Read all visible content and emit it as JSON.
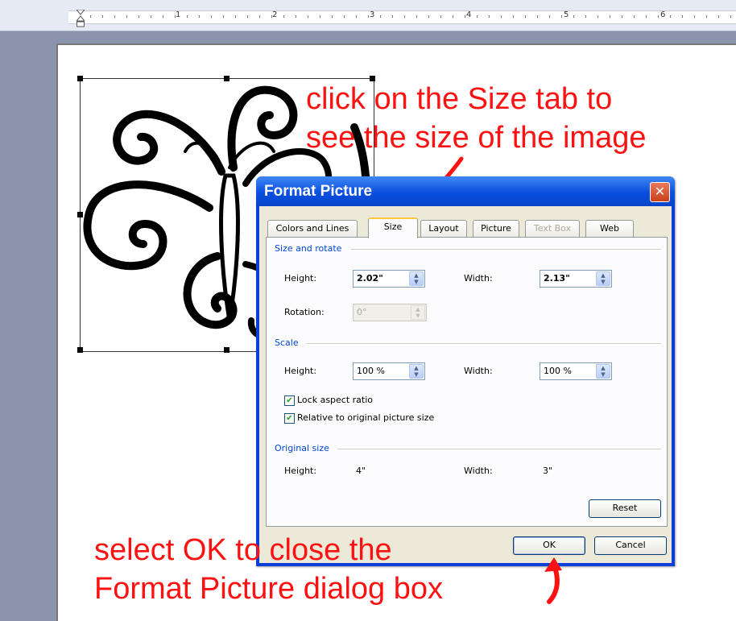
{
  "ruler": {
    "numbers": [
      "1",
      "2",
      "3",
      "4",
      "5",
      "6"
    ]
  },
  "annotations": {
    "top_line1": "click on the Size tab to",
    "top_line2": "see the size of the image",
    "bottom_line1": "select OK to close the",
    "bottom_line2": "Format Picture dialog box"
  },
  "dialog": {
    "title": "Format Picture",
    "close_icon": "close-icon",
    "tabs": [
      {
        "label": "Colors and Lines",
        "state": "normal"
      },
      {
        "label": "Size",
        "state": "active"
      },
      {
        "label": "Layout",
        "state": "normal"
      },
      {
        "label": "Picture",
        "state": "normal"
      },
      {
        "label": "Text Box",
        "state": "disabled"
      },
      {
        "label": "Web",
        "state": "normal"
      }
    ],
    "size_rotate": {
      "title": "Size and rotate",
      "height_label": "Height:",
      "height_value": "2.02\"",
      "width_label": "Width:",
      "width_value": "2.13\"",
      "rotation_label": "Rotation:",
      "rotation_value": "0°"
    },
    "scale": {
      "title": "Scale",
      "height_label": "Height:",
      "height_value": "100 %",
      "width_label": "Width:",
      "width_value": "100 %",
      "lock_aspect": "Lock aspect ratio",
      "relative": "Relative to original picture size",
      "lock_checked": true,
      "relative_checked": true
    },
    "original": {
      "title": "Original size",
      "height_label": "Height:",
      "height_value": "4\"",
      "width_label": "Width:",
      "width_value": "3\""
    },
    "reset_label": "Reset",
    "ok_label": "OK",
    "cancel_label": "Cancel"
  },
  "colors": {
    "annotation": "#ff1111",
    "title_bar": "#0a4fe0",
    "dialog_bg": "#ece9d8"
  }
}
